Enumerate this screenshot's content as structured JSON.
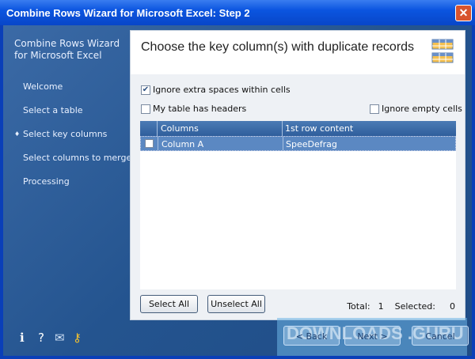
{
  "window": {
    "title": "Combine Rows Wizard for Microsoft Excel: Step 2",
    "close_icon": "close-icon"
  },
  "sidebar": {
    "title": "Combine Rows Wizard for Microsoft Excel",
    "items": [
      {
        "label": "Welcome"
      },
      {
        "label": "Select a table"
      },
      {
        "label": "Select key columns",
        "active": true
      },
      {
        "label": "Select columns to merge"
      },
      {
        "label": "Processing"
      }
    ]
  },
  "panel": {
    "heading": "Choose the key column(s) with duplicate records",
    "options": {
      "ignore_spaces": {
        "label": "Ignore extra spaces within cells",
        "checked": true
      },
      "has_headers": {
        "label": "My table has headers",
        "checked": false
      },
      "ignore_empty": {
        "label": "Ignore empty cells",
        "checked": false
      }
    },
    "table": {
      "headers": [
        "Columns",
        "1st row content"
      ],
      "rows": [
        {
          "column": "Column A",
          "content": "SpeeDefrag",
          "checked": false
        }
      ]
    },
    "select_all": "Select All",
    "unselect_all": "Unselect All",
    "total_label": "Total:",
    "total": "1",
    "selected_label": "Selected:",
    "selected": "0"
  },
  "footer": {
    "back": "< Back",
    "next": "Next >",
    "cancel": "Cancel",
    "icons": [
      "info-icon",
      "help-icon",
      "mail-icon",
      "key-icon"
    ]
  },
  "watermark": "DOWNLOADS .GURU"
}
